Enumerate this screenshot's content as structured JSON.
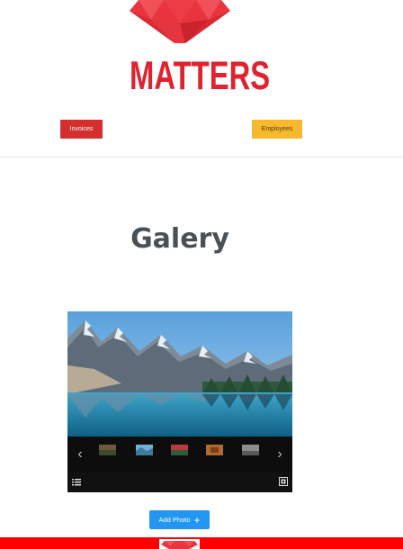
{
  "brand": {
    "logo_text": "MATTERS",
    "accent": "#e0232f"
  },
  "nav": {
    "invoices_label": "Invoices",
    "employees_label": "Employees",
    "invoices_color": "#d32f2f",
    "employees_color": "#f5b82e"
  },
  "main": {
    "title": "Galery"
  },
  "gallery": {
    "prev_icon": "chevron-left-icon",
    "next_icon": "chevron-right-icon",
    "toolbar_left_icon": "list-icon",
    "toolbar_right_icon": "fullscreen-icon",
    "thumbnail_count": 5
  },
  "actions": {
    "add_photo_label": "Add Photo",
    "add_photo_color": "#2196f3"
  },
  "footer": {
    "color": "#ff0000"
  }
}
